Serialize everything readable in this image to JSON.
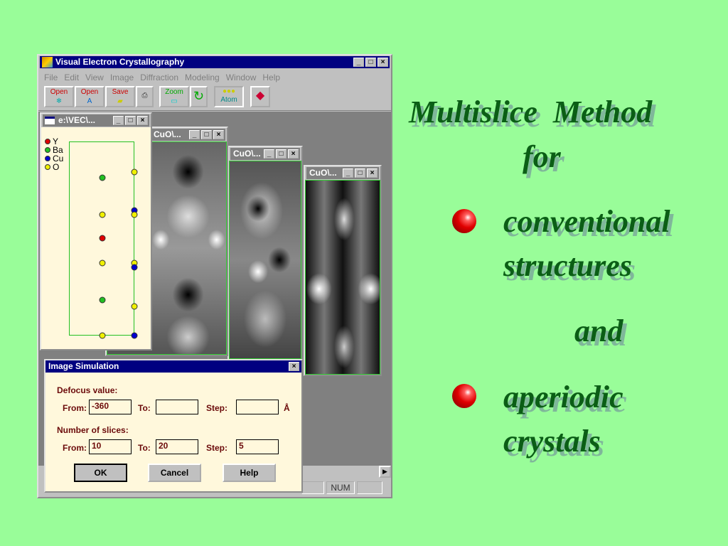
{
  "app": {
    "title": "Visual Electron Crystallography",
    "menu": [
      "File",
      "Edit",
      "View",
      "Image",
      "Diffraction",
      "Modeling",
      "Window",
      "Help"
    ],
    "toolbar": [
      "Open",
      "Open",
      "Save",
      "Print",
      "Zoom",
      "Refresh",
      "Atom",
      "Help book"
    ],
    "status": {
      "num": "NUM"
    }
  },
  "structure_window": {
    "title": "e:\\VEC\\...",
    "legend": [
      {
        "label": "Y",
        "color": "#e00000"
      },
      {
        "label": "Ba",
        "color": "#22c022"
      },
      {
        "label": "Cu",
        "color": "#0000d0"
      },
      {
        "label": "O",
        "color": "#f0f000"
      }
    ]
  },
  "image_windows": [
    {
      "title": "CuO\\..."
    },
    {
      "title": "CuO\\..."
    },
    {
      "title": "CuO\\..."
    }
  ],
  "dialog": {
    "title": "Image Simulation",
    "defocus_label": "Defocus value:",
    "slices_label": "Number of slices:",
    "from": "From:",
    "to": "To:",
    "step": "Step:",
    "unit": "Å",
    "defocus": {
      "from": "-360",
      "to": "",
      "step": ""
    },
    "slices": {
      "from": "10",
      "to": "20",
      "step": "5"
    },
    "ok": "OK",
    "cancel": "Cancel",
    "help": "Help"
  },
  "slide": {
    "title1": "Multislice  Method",
    "title2": "for",
    "bullet1a": "conventional",
    "bullet1b": "structures",
    "and": "and",
    "bullet2a": "aperiodic",
    "bullet2b": "crystals"
  }
}
